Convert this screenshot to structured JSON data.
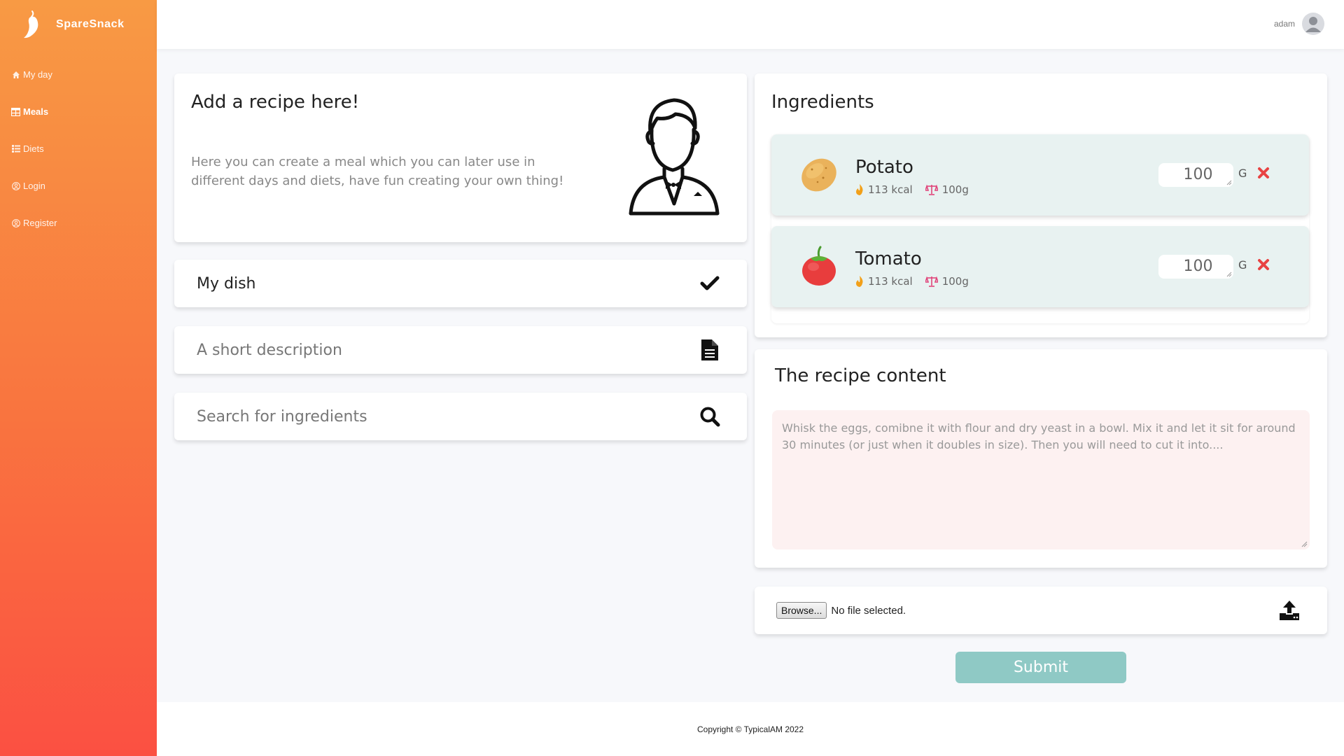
{
  "brand": {
    "name": "SpareSnack"
  },
  "sidebar": {
    "items": [
      {
        "label": "My day",
        "icon": "home-icon"
      },
      {
        "label": "Meals",
        "icon": "table-icon",
        "active": true
      },
      {
        "label": "Diets",
        "icon": "list-icon"
      },
      {
        "label": "Login",
        "icon": "user-circle-icon"
      },
      {
        "label": "Register",
        "icon": "user-circle-icon"
      }
    ]
  },
  "header": {
    "username": "adam"
  },
  "intro": {
    "title": "Add a recipe here!",
    "text": "Here you can create a meal which you can later use in different days and diets, have fun creating your own thing!"
  },
  "form": {
    "dish_name": "My dish",
    "description_placeholder": "A short description",
    "search_placeholder": "Search for ingredients"
  },
  "ingredients": {
    "title": "Ingredients",
    "items": [
      {
        "name": "Potato",
        "kcal": "113 kcal",
        "weight": "100g",
        "quantity": "100",
        "unit": "G"
      },
      {
        "name": "Tomato",
        "kcal": "113 kcal",
        "weight": "100g",
        "quantity": "100",
        "unit": "G"
      }
    ]
  },
  "recipe": {
    "title": "The recipe content",
    "placeholder": "Whisk the eggs, comibne it with flour and dry yeast in a bowl. Mix it and let it sit for around 30 minutes (or just when it doubles in size). Then you will need to cut it into...."
  },
  "upload": {
    "button_label": "Browse...",
    "status": "No file selected."
  },
  "submit_label": "Submit",
  "footer": {
    "copyright": "Copyright © TypicalAM 2022"
  },
  "colors": {
    "sidebar_top": "#f89a44",
    "sidebar_bottom": "#fb5042",
    "ingredient_bg": "#e8f2f1",
    "recipe_bg": "#fdf1f1",
    "submit_bg": "#8fc9c5",
    "remove_red": "#e84343"
  }
}
